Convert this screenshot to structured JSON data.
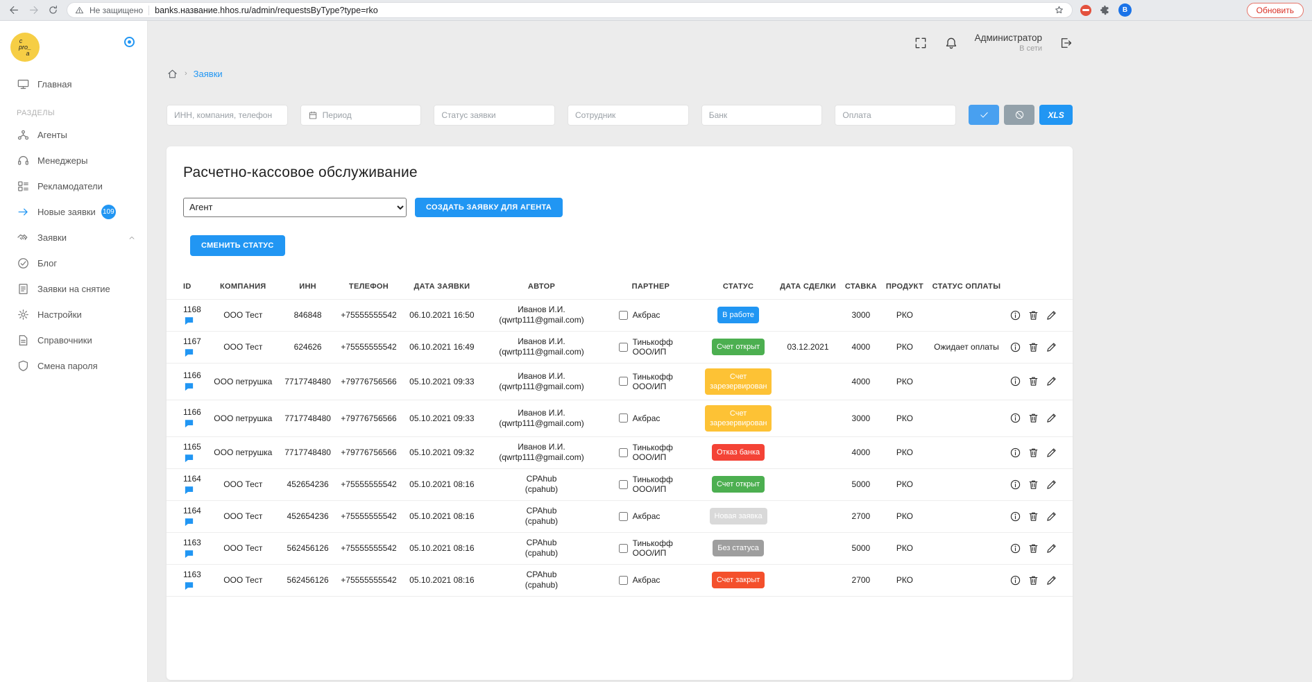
{
  "browser": {
    "security_warning": "Не защищено",
    "url": "banks.название.hhos.ru/admin/requestsByType?type=rko",
    "refresh_button": "Обновить",
    "profile_initial": "B"
  },
  "header": {
    "user_name": "Администратор",
    "user_status": "В сети"
  },
  "breadcrumb": {
    "separator": "›",
    "current": "Заявки"
  },
  "sidebar": {
    "logo_lines": [
      "c",
      "pro_",
      "a"
    ],
    "items": [
      {
        "key": "home",
        "label": "Главная",
        "icon": "display-icon"
      },
      {
        "type": "section",
        "label": "РАЗДЕЛЫ"
      },
      {
        "key": "agents",
        "label": "Агенты",
        "icon": "agents-icon"
      },
      {
        "key": "managers",
        "label": "Менеджеры",
        "icon": "headset-icon"
      },
      {
        "key": "advertisers",
        "label": "Рекламодатели",
        "icon": "advertisers-icon"
      },
      {
        "key": "new-requests",
        "label": "Новые заявки",
        "icon": "arrow-right-icon",
        "icon_accent": true,
        "badge": "109"
      },
      {
        "key": "requests",
        "label": "Заявки",
        "icon": "requests-icon",
        "expanded": true
      },
      {
        "key": "blog",
        "label": "Блог",
        "icon": "check-circle-icon"
      },
      {
        "key": "withdrawal-requests",
        "label": "Заявки на снятие",
        "icon": "document-icon"
      },
      {
        "key": "settings",
        "label": "Настройки",
        "icon": "gear-icon"
      },
      {
        "key": "directories",
        "label": "Справочники",
        "icon": "book-icon"
      },
      {
        "key": "change-password",
        "label": "Смена пароля",
        "icon": "shield-icon"
      }
    ]
  },
  "filters": {
    "fields": [
      {
        "key": "query",
        "placeholder": "ИНН, компания, телефон"
      },
      {
        "key": "period",
        "placeholder": "Период",
        "icon": "calendar-icon"
      },
      {
        "key": "request-status",
        "placeholder": "Статус заявки"
      },
      {
        "key": "employee",
        "placeholder": "Сотрудник"
      },
      {
        "key": "bank",
        "placeholder": "Банк"
      },
      {
        "key": "payment",
        "placeholder": "Оплата"
      }
    ],
    "xls_label": "XLS"
  },
  "main": {
    "title": "Расчетно-кассовое обслуживание",
    "agent_select_value": "Агент",
    "create_request_button": "СОЗДАТЬ ЗАЯВКУ ДЛЯ АГЕНТА",
    "change_status_button": "СМЕНИТЬ СТАТУС"
  },
  "table": {
    "columns": [
      "ID",
      "КОМПАНИЯ",
      "ИНН",
      "ТЕЛЕФОН",
      "ДАТА ЗАЯВКИ",
      "АВТОР",
      "ПАРТНЕР",
      "СТАТУС",
      "ДАТА СДЕЛКИ",
      "СТАВКА",
      "ПРОДУКТ",
      "СТАТУС ОПЛАТЫ"
    ],
    "rows": [
      {
        "id": "1168",
        "company": "ООО Тест",
        "inn": "846848",
        "phone": "+75555555542",
        "request_date": "06.10.2021 16:50",
        "author_name": "Иванов И.И.",
        "author_email": "(qwrtp111@gmail.com)",
        "partner": "Акбрас",
        "partner_checked": false,
        "status": "В работе",
        "status_color": "#2196f3",
        "deal_date": "",
        "rate": "3000",
        "product": "РКО",
        "payment_status": ""
      },
      {
        "id": "1167",
        "company": "ООО Тест",
        "inn": "624626",
        "phone": "+75555555542",
        "request_date": "06.10.2021 16:49",
        "author_name": "Иванов И.И.",
        "author_email": "(qwrtp111@gmail.com)",
        "partner": "Тинькофф ООО/ИП",
        "partner_checked": false,
        "status": "Счет открыт",
        "status_color": "#4caf50",
        "deal_date": "03.12.2021",
        "rate": "4000",
        "product": "РКО",
        "payment_status": "Ожидает оплаты"
      },
      {
        "id": "1166",
        "company": "ООО петрушка",
        "inn": "7717748480",
        "phone": "+79776756566",
        "request_date": "05.10.2021 09:33",
        "author_name": "Иванов И.И.",
        "author_email": "(qwrtp111@gmail.com)",
        "partner": "Тинькофф ООО/ИП",
        "partner_checked": false,
        "status": "Счет зарезервирован",
        "status_color": "#fdc235",
        "deal_date": "",
        "rate": "4000",
        "product": "РКО",
        "payment_status": ""
      },
      {
        "id": "1166",
        "company": "ООО петрушка",
        "inn": "7717748480",
        "phone": "+79776756566",
        "request_date": "05.10.2021 09:33",
        "author_name": "Иванов И.И.",
        "author_email": "(qwrtp111@gmail.com)",
        "partner": "Акбрас",
        "partner_checked": false,
        "status": "Счет зарезервирован",
        "status_color": "#fdc235",
        "deal_date": "",
        "rate": "3000",
        "product": "РКО",
        "payment_status": ""
      },
      {
        "id": "1165",
        "company": "ООО петрушка",
        "inn": "7717748480",
        "phone": "+79776756566",
        "request_date": "05.10.2021 09:32",
        "author_name": "Иванов И.И.",
        "author_email": "(qwrtp111@gmail.com)",
        "partner": "Тинькофф ООО/ИП",
        "partner_checked": false,
        "status": "Отказ банка",
        "status_color": "#f44336",
        "deal_date": "",
        "rate": "4000",
        "product": "РКО",
        "payment_status": ""
      },
      {
        "id": "1164",
        "company": "ООО Тест",
        "inn": "452654236",
        "phone": "+75555555542",
        "request_date": "05.10.2021 08:16",
        "author_name": "CPAhub",
        "author_email": "(cpahub)",
        "partner": "Тинькофф ООО/ИП",
        "partner_checked": false,
        "status": "Счет открыт",
        "status_color": "#4caf50",
        "deal_date": "",
        "rate": "5000",
        "product": "РКО",
        "payment_status": ""
      },
      {
        "id": "1164",
        "company": "ООО Тест",
        "inn": "452654236",
        "phone": "+75555555542",
        "request_date": "05.10.2021 08:16",
        "author_name": "CPAhub",
        "author_email": "(cpahub)",
        "partner": "Акбрас",
        "partner_checked": false,
        "status": "Новая заявка",
        "status_color": "#d9d9d9",
        "deal_date": "",
        "rate": "2700",
        "product": "РКО",
        "payment_status": ""
      },
      {
        "id": "1163",
        "company": "ООО Тест",
        "inn": "562456126",
        "phone": "+75555555542",
        "request_date": "05.10.2021 08:16",
        "author_name": "CPAhub",
        "author_email": "(cpahub)",
        "partner": "Тинькофф ООО/ИП",
        "partner_checked": false,
        "status": "Без статуса",
        "status_color": "#9e9e9e",
        "deal_date": "",
        "rate": "5000",
        "product": "РКО",
        "payment_status": ""
      },
      {
        "id": "1163",
        "company": "ООО Тест",
        "inn": "562456126",
        "phone": "+75555555542",
        "request_date": "05.10.2021 08:16",
        "author_name": "CPAhub",
        "author_email": "(cpahub)",
        "partner": "Акбрас",
        "partner_checked": false,
        "status": "Счет закрыт",
        "status_color": "#f4502c",
        "deal_date": "",
        "rate": "2700",
        "product": "РКО",
        "payment_status": ""
      }
    ]
  },
  "colors": {
    "accent": "#2196f3",
    "status_in_work": "#2196f3",
    "status_account_open": "#4caf50",
    "status_account_reserved": "#fdc235",
    "status_bank_refusal": "#f44336",
    "status_new_request": "#d9d9d9",
    "status_no_status": "#9e9e9e",
    "status_account_closed": "#f4502c"
  },
  "icons": {
    "back-icon": "←",
    "forward-icon": "→",
    "refresh-icon": "⟳",
    "warning-icon": "⚠",
    "star-icon": "☆",
    "puzzle-icon": "puzzle-piece",
    "adblock-icon": "red-circle",
    "fullscreen-icon": "⛶",
    "bell-icon": "bell",
    "logout-icon": "exit-door",
    "home-icon": "⌂",
    "calendar-icon": "calendar",
    "check-icon": "✓",
    "ban-icon": "⃠",
    "chat-icon": "speech-bubble",
    "info-icon": "ⓘ",
    "trash-icon": "trash-can",
    "pencil-icon": "✎",
    "chevron-up-icon": "^",
    "target-icon": "◎"
  }
}
